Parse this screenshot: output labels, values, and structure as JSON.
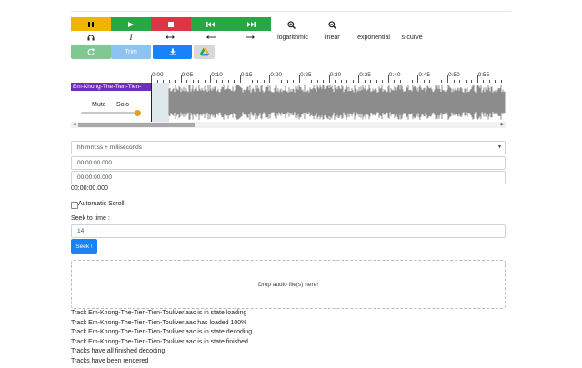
{
  "colors": {
    "pause": "#f0b500",
    "play": "#28a745",
    "stop": "#dc3545",
    "skip": "#28a745",
    "success_light": "#7fc892",
    "info_light": "#8bc4f2",
    "primary": "#1a82f7",
    "track_name": "#6f2dbd",
    "volume_knob": "#e5a11a",
    "waveform": "#8c8c8c"
  },
  "transport": {
    "buttons": [
      {
        "name": "pause-button",
        "icon": "pause-icon"
      },
      {
        "name": "play-button",
        "icon": "play-icon"
      },
      {
        "name": "stop-button",
        "icon": "stop-icon"
      },
      {
        "name": "rewind-button",
        "icon": "skip-backward-icon"
      },
      {
        "name": "fast-forward-button",
        "icon": "skip-forward-icon"
      }
    ],
    "zoom_in_icon": "zoom-in-icon",
    "zoom_out_icon": "zoom-out-icon"
  },
  "tools": {
    "icons": [
      "headphones-icon",
      "cursor-text-icon",
      "arrows-horizontal-icon",
      "arrow-left-icon",
      "arrow-right-icon"
    ],
    "fades": [
      "logarithmic",
      "linear",
      "exponential",
      "s-curve"
    ]
  },
  "actions": {
    "refresh_icon": "refresh-icon",
    "trim_label": "Trim",
    "download_icon": "download-icon",
    "drive_icon": "google-drive-icon"
  },
  "track": {
    "name": "Em-Khong-The-Tien-Tien-",
    "mute_label": "Mute",
    "solo_label": "Solo",
    "volume": 0.95
  },
  "timeline": {
    "ticks": [
      "0:00",
      "0:05",
      "0:10",
      "0:15",
      "0:20",
      "0:25",
      "0:30",
      "0:35",
      "0:40",
      "0:45",
      "0:50",
      "0:55"
    ]
  },
  "time_format": {
    "selected": "hh:mm:ss + milliseconds",
    "start": "00:00:00.000",
    "end": "00:00:00.000",
    "current": "00:00:00.000"
  },
  "scroll": {
    "automatic_label": "Automatic Scroll",
    "checked": false
  },
  "seek": {
    "label": "Seek to time :",
    "value": "14",
    "button": "Seek !"
  },
  "dropzone": {
    "text": "Drop audio file(s) here!"
  },
  "log": [
    "Track Em-Khong-The-Tien-Tien-Touliver.aac is in state loading",
    "Track Em-Khong-The-Tien-Tien-Touliver.aac has loaded 100%",
    "Track Em-Khong-The-Tien-Tien-Touliver.aac is in state decoding",
    "Track Em-Khong-The-Tien-Tien-Touliver.aac is in state finished",
    "Tracks have all finished decoding.",
    "Tracks have been rendered"
  ]
}
